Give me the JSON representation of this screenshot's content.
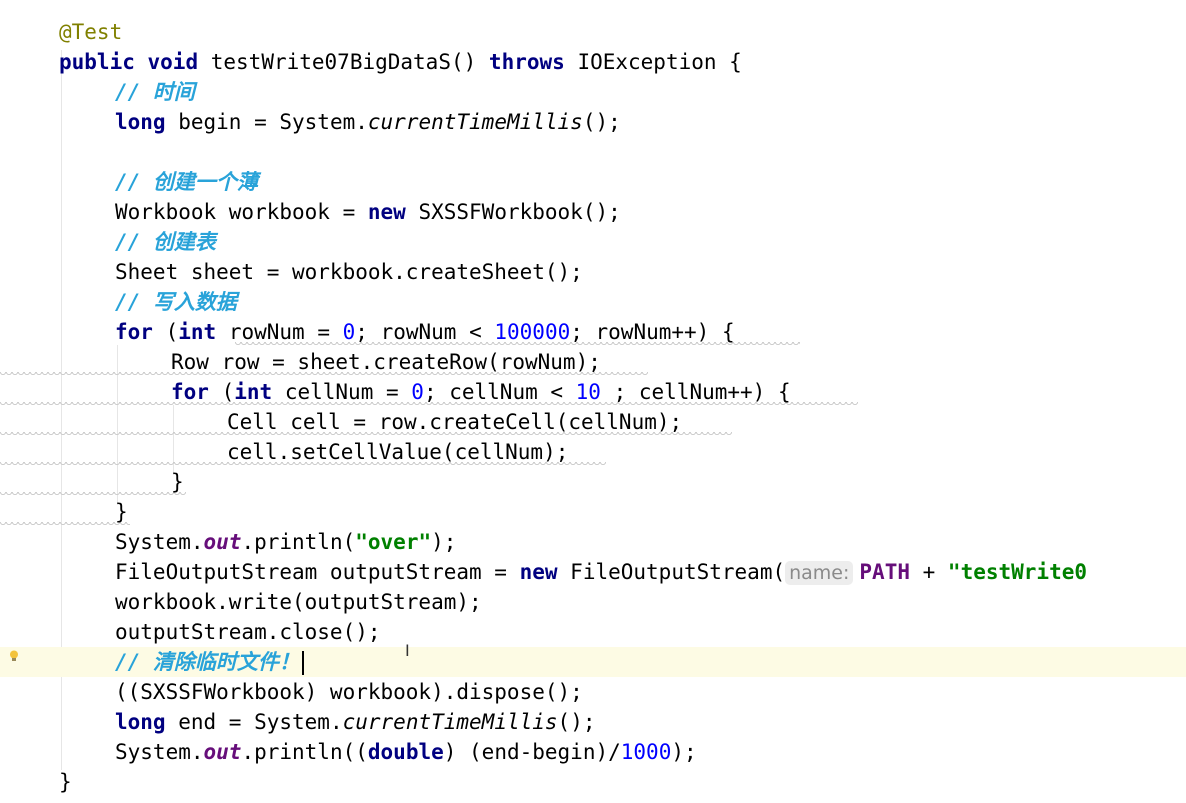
{
  "editor": {
    "annotation": "@Test",
    "method": {
      "kw_public": "public",
      "kw_void": "void",
      "name": "testWrite07BigDataS()",
      "kw_throws": "throws",
      "exception": "IOException {"
    },
    "c_time": "// 时间",
    "begin": {
      "kw": "long",
      "pre": "begin = System.",
      "call": "currentTimeMillis",
      "post": "();"
    },
    "c_create_book": "// 创建一个薄",
    "workbook": {
      "pre": "Workbook workbook = ",
      "kw": "new",
      "post": "SXSSFWorkbook();"
    },
    "c_create_sheet": "// 创建表",
    "sheet": "Sheet sheet = workbook.createSheet();",
    "c_write": "// 写入数据",
    "for_row": {
      "kw_for": "for",
      "open": "(",
      "kw_int": "int",
      "a": "rowNum = ",
      "zero": "0",
      "b": "; rowNum < ",
      "limit": "100000",
      "c": "; rowNum++) {"
    },
    "row": "Row row = sheet.createRow(rowNum);",
    "for_cell": {
      "kw_for": "for",
      "open": "(",
      "kw_int": "int",
      "a": "cellNum = ",
      "zero": "0",
      "b": "; cellNum < ",
      "limit": "10",
      "c": " ; cellNum++) {"
    },
    "cell": "Cell cell = row.createCell(cellNum);",
    "set_value": "cell.setCellValue(cellNum);",
    "close_inner": "}",
    "close_outer": "}",
    "print_over": {
      "pre": "System.",
      "field": "out",
      "mid": ".println(",
      "str": "\"over\"",
      "post": ");"
    },
    "fos": {
      "pre": "FileOutputStream outputStream = ",
      "kw": "new",
      "mid": "FileOutputStream(",
      "hint": "name:",
      "const": "PATH",
      "plus": " + ",
      "str": "\"testWrite0"
    },
    "wb_write": "workbook.write(outputStream);",
    "os_close": "outputStream.close();",
    "c_clear": "// 清除临时文件！",
    "dispose": "((SXSSFWorkbook) workbook).dispose();",
    "end": {
      "kw": "long",
      "pre": "end = System.",
      "call": "currentTimeMillis",
      "post": "();"
    },
    "print_time": {
      "pre": "System.",
      "field": "out",
      "mid": ".println((",
      "kw": "double",
      "post1": ") (end-begin)/",
      "num": "1000",
      "post2": ");"
    },
    "close_method": "}",
    "gutter_icon": "lightbulb-icon",
    "cursor_icon": "text-cursor-icon"
  }
}
